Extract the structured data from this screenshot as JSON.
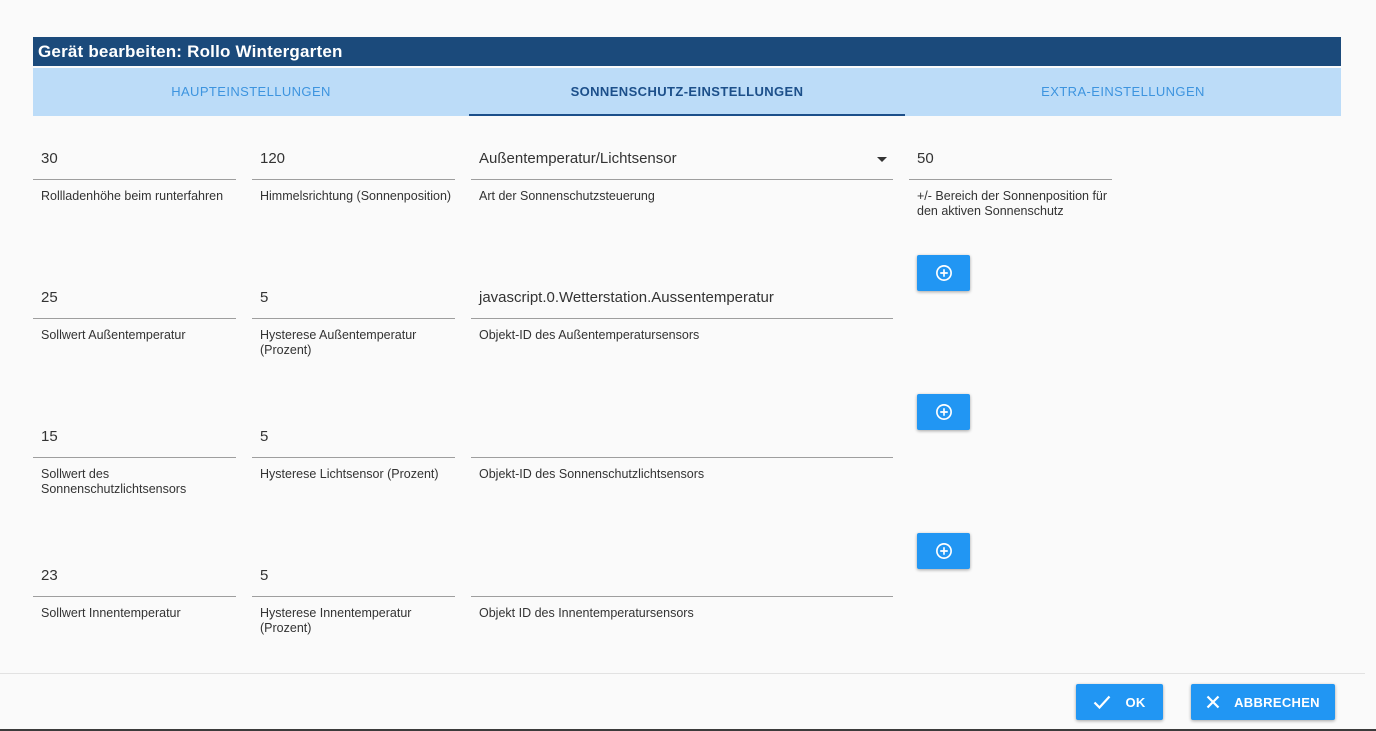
{
  "dialog": {
    "title": "Gerät bearbeiten: Rollo Wintergarten"
  },
  "tabs": [
    {
      "label": "HAUPTEINSTELLUNGEN",
      "active": false
    },
    {
      "label": "SONNENSCHUTZ-EINSTELLUNGEN",
      "active": true
    },
    {
      "label": "EXTRA-EINSTELLUNGEN",
      "active": false
    }
  ],
  "rows": [
    {
      "height": {
        "value": "30",
        "label": "Rollladenhöhe beim runterfahren"
      },
      "direction": {
        "value": "120",
        "label": "Himmelsrichtung (Sonnenposition)"
      },
      "mode": {
        "value": "Außentemperatur/Lichtsensor",
        "label": "Art der Sonnenschutzsteuerung"
      },
      "range": {
        "value": "50",
        "label": "+/- Bereich der Sonnenposition für den aktiven Sonnenschutz"
      }
    },
    {
      "setpoint": {
        "value": "25",
        "label": "Sollwert Außentemperatur"
      },
      "hysteresis": {
        "value": "5",
        "label": "Hysterese Außentemperatur (Prozent)"
      },
      "object": {
        "value": "javascript.0.Wetterstation.Aussentemperatur",
        "label": "Objekt-ID des Außentemperatursensors"
      }
    },
    {
      "setpoint": {
        "value": "15",
        "label": "Sollwert des Sonnenschutzlichtsensors"
      },
      "hysteresis": {
        "value": "5",
        "label": "Hysterese Lichtsensor (Prozent)"
      },
      "object": {
        "value": "",
        "label": "Objekt-ID des Sonnenschutzlichtsensors"
      }
    },
    {
      "setpoint": {
        "value": "23",
        "label": "Sollwert Innentemperatur"
      },
      "hysteresis": {
        "value": "5",
        "label": "Hysterese Innentemperatur (Prozent)"
      },
      "object": {
        "value": "",
        "label": "Objekt ID des Innentemperatursensors"
      }
    }
  ],
  "footer": {
    "ok_label": "OK",
    "cancel_label": "ABBRECHEN"
  },
  "icons": {
    "add": "plus-circle-icon",
    "ok": "check-icon",
    "cancel": "close-icon",
    "select": "caret-down-icon"
  },
  "colors": {
    "titlebar": "#1b4a7b",
    "tabbar": "#bcdcf8",
    "tab_active": "#1c4f8a",
    "tab_inactive": "#3d94df",
    "button": "#2196f3"
  }
}
